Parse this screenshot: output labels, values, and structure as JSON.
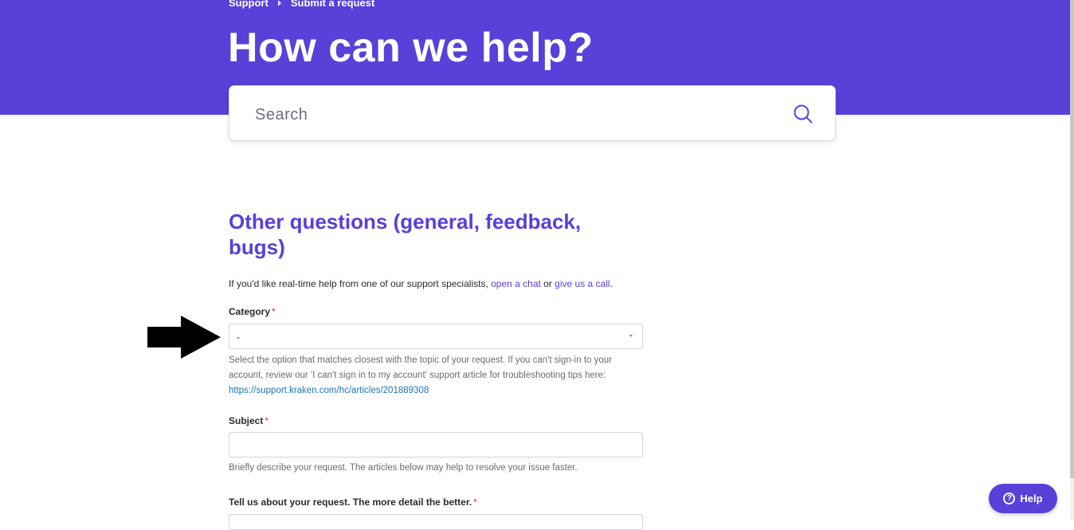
{
  "breadcrumb": {
    "items": [
      "Support",
      "Submit a request"
    ]
  },
  "hero": {
    "title": "How can we help?"
  },
  "search": {
    "placeholder": "Search",
    "icon": "search-icon"
  },
  "form": {
    "title": "Other questions (general, feedback, bugs)",
    "intro": {
      "prefix": "If you'd like real-time help from one of our support specialists, ",
      "chat_link": "open a chat",
      "middle": " or ",
      "call_link": "give us a call",
      "suffix": "."
    },
    "category": {
      "label": "Category",
      "required_mark": "*",
      "selected": "-",
      "hint": "Select the option that matches closest with the topic of your request. If you can't sign-in to your account, review our 'I can't sign in to my account' support article for troubleshooting tips here: ",
      "hint_link": "https://support.kraken.com/hc/articles/201889308"
    },
    "subject": {
      "label": "Subject",
      "required_mark": "*",
      "value": "",
      "hint": "Briefly describe your request. The articles below may help to resolve your issue faster."
    },
    "description": {
      "label": "Tell us about your request. The more detail the better.",
      "required_mark": "*"
    }
  },
  "help_widget": {
    "label": "Help",
    "icon": "question-icon",
    "glyph": "?"
  },
  "colors": {
    "brand": "#5741d9",
    "link": "#1f73b7",
    "required": "#d93025"
  }
}
